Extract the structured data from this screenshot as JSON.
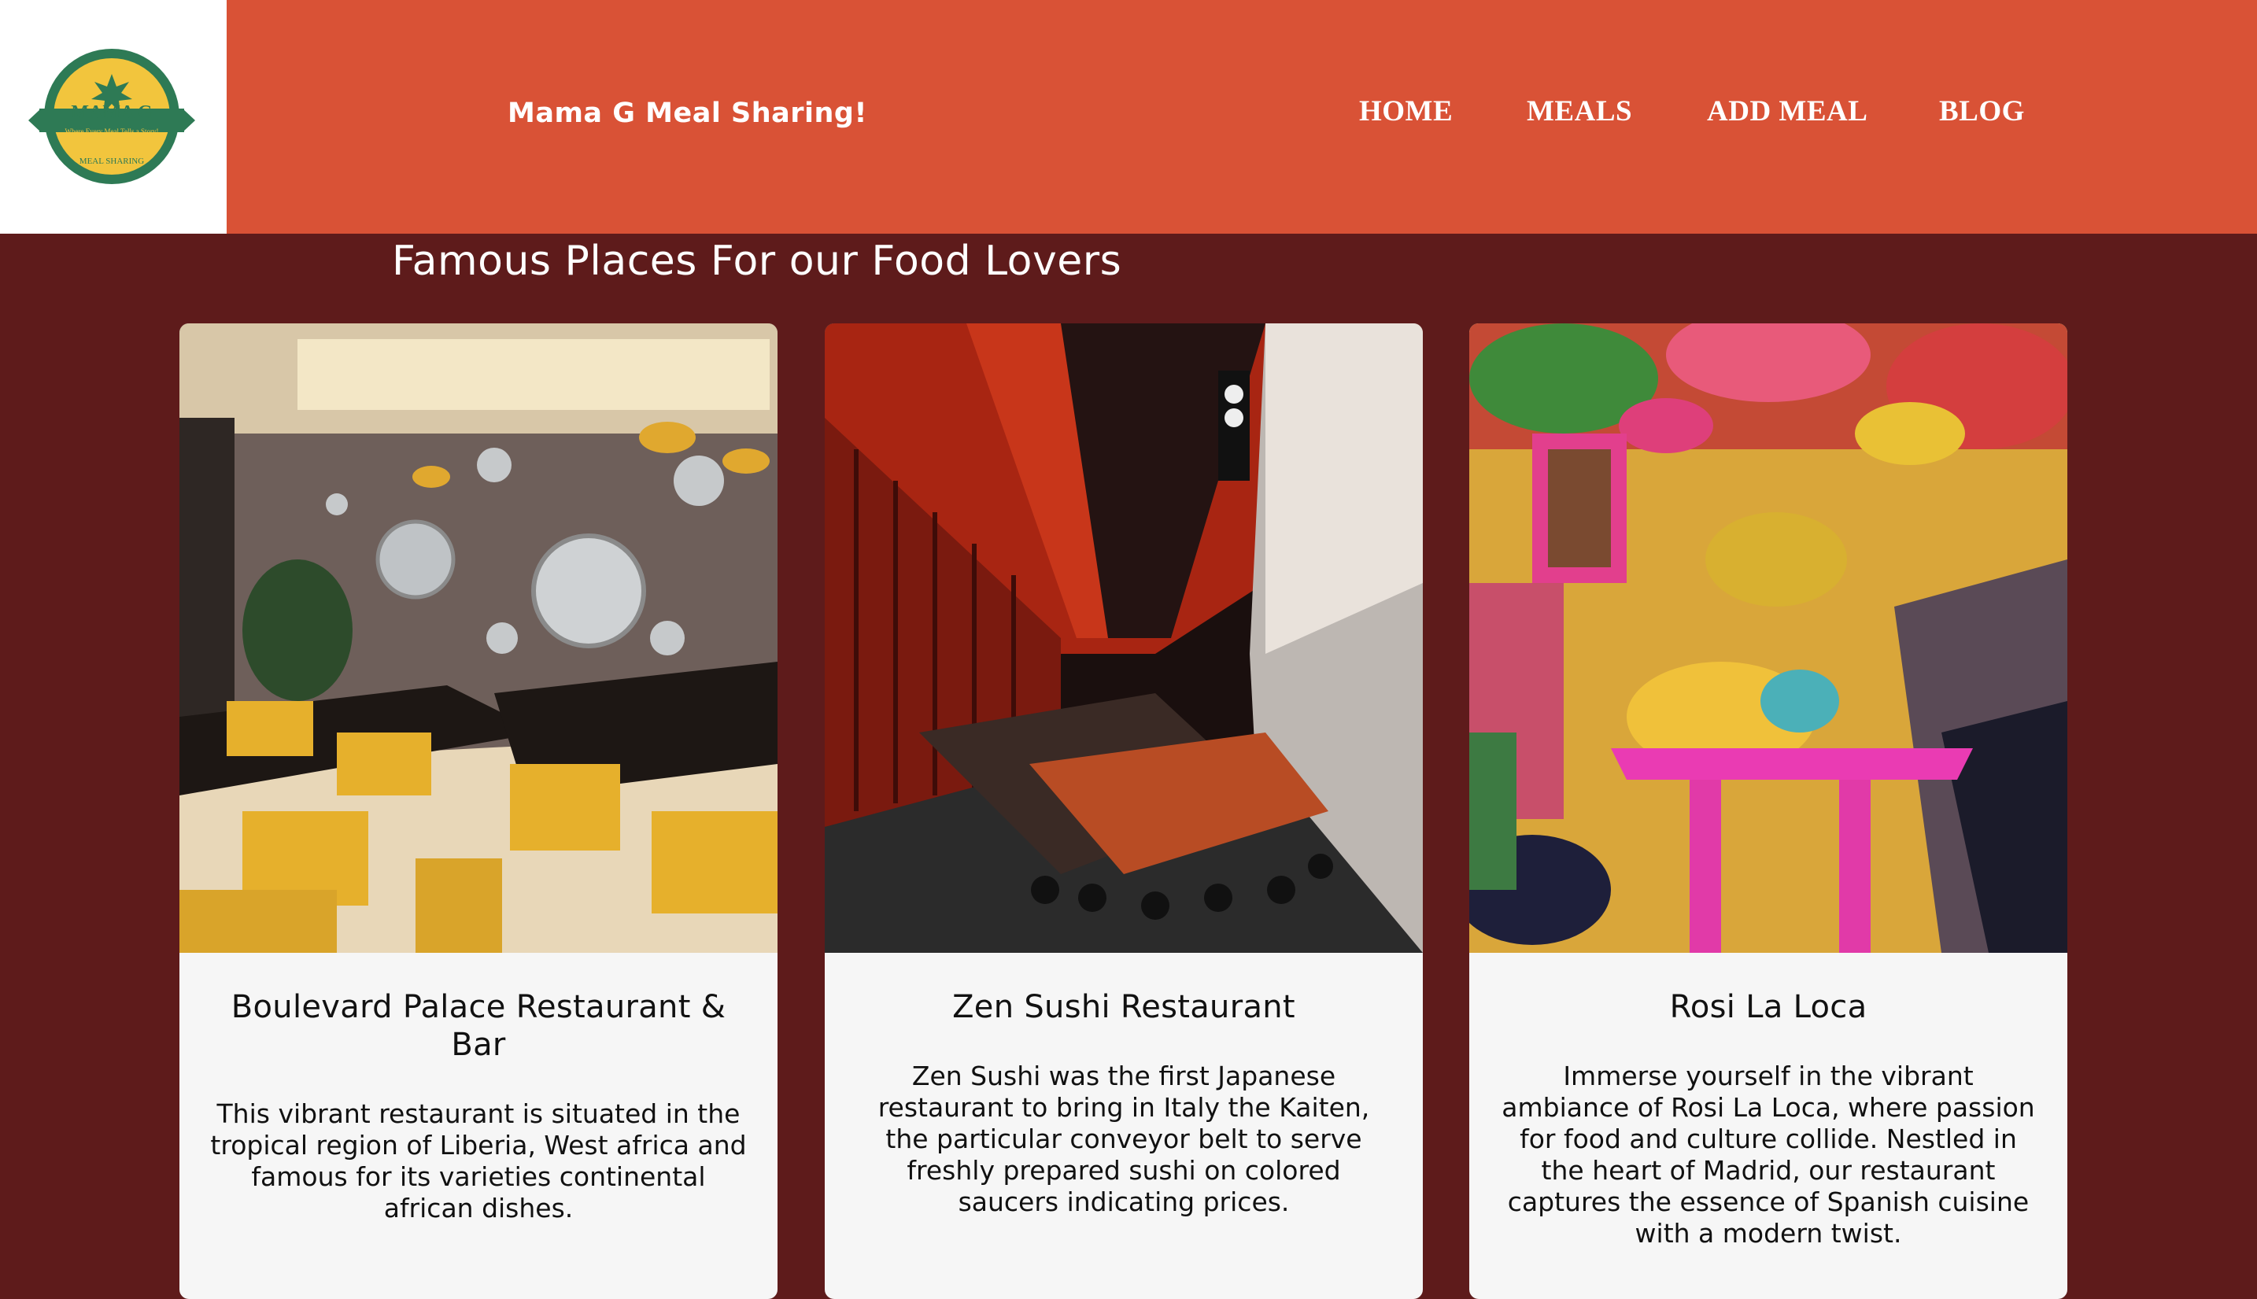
{
  "header": {
    "logo_text": "MAMA G",
    "logo_tagline": "Where Every Meal Tells a Story!",
    "logo_subtext": "MEAL SHARING",
    "site_title": "Mama G Meal Sharing!",
    "nav": [
      "HOME",
      "MEALS",
      "ADD MEAL",
      "BLOG"
    ]
  },
  "main": {
    "section_title": "Famous Places For our Food Lovers",
    "cards": [
      {
        "title": "Boulevard Palace Restaurant & Bar",
        "description": "This vibrant restaurant is situated in the tropical region of Liberia, West africa and famous for its varieties continental african dishes."
      },
      {
        "title": "Zen Sushi Restaurant",
        "description": "Zen Sushi was the first Japanese restaurant to bring in Italy the Kaiten, the particular conveyor belt to serve freshly prepared sushi on colored saucers indicating prices."
      },
      {
        "title": "Rosi La Loca",
        "description": "Immerse yourself in the vibrant ambiance of Rosi La Loca, where passion for food and culture collide. Nestled in the heart of Madrid, our restaurant captures the essence of Spanish cuisine with a modern twist."
      }
    ]
  },
  "colors": {
    "header_bg": "#d95236",
    "page_bg": "#5e1b1b",
    "card_bg": "#f6f6f6",
    "logo_green": "#2e7a55",
    "logo_yellow": "#f2c53d"
  }
}
